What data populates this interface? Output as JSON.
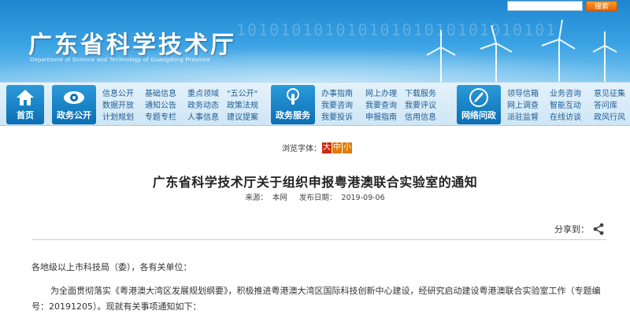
{
  "header": {
    "site_title": "广东省科学技术厅",
    "site_subtitle": "Department of Science and Technology of Guangdong Province",
    "search_button": "搜索",
    "binary_text": "10101010101010101010101010101"
  },
  "nav": {
    "home": "首页",
    "gov_affairs": "政务公开",
    "gov_service": "政务服务",
    "online_interaction": "网络问政",
    "group1": [
      [
        "信息公开",
        "数据开放",
        "计划规划"
      ],
      [
        "基础信息",
        "通知公告",
        "专题专栏"
      ],
      [
        "重点领域",
        "政务动态",
        "人事信息"
      ],
      [
        "\"五公开\"",
        "政策法规",
        "建议提案"
      ]
    ],
    "group2": [
      [
        "办事指南",
        "我要咨询",
        "我要投诉"
      ],
      [
        "网上办理",
        "我要查询",
        "申报指南"
      ],
      [
        "下载服务",
        "我要评议",
        "信用信息"
      ]
    ],
    "group3": [
      [
        "领导信箱",
        "网上调查",
        "派驻监督"
      ],
      [
        "业务咨询",
        "智能互动",
        "在线访谈"
      ],
      [
        "意见征集",
        "答问库",
        "政风行风"
      ]
    ]
  },
  "article": {
    "font_size_label": "浏览字体：",
    "font_sizes": [
      "大",
      "中",
      "小"
    ],
    "title": "广东省科学技术厅关于组织申报粤港澳联合实验室的通知",
    "source_label": "来源：",
    "source": "本网",
    "date_label": "发布日期：",
    "date": "2019-09-06",
    "share_label": "分享到：",
    "salutation": "各地级以上市科技局（委），各有关单位：",
    "paragraph1": "为全面贯彻落实《粤港澳大湾区发展规划纲要》，积极推进粤港澳大湾区国际科技创新中心建设，经研究启动建设粤港澳联合实验室工作（专题编号：20191205）。现就有关事项通知如下："
  },
  "colors": {
    "banner_top": "#1d86cf",
    "nav_blue": "#0b6fb4",
    "font_btn_orange": "#e07b00",
    "font_btn_red": "#c62c10"
  }
}
